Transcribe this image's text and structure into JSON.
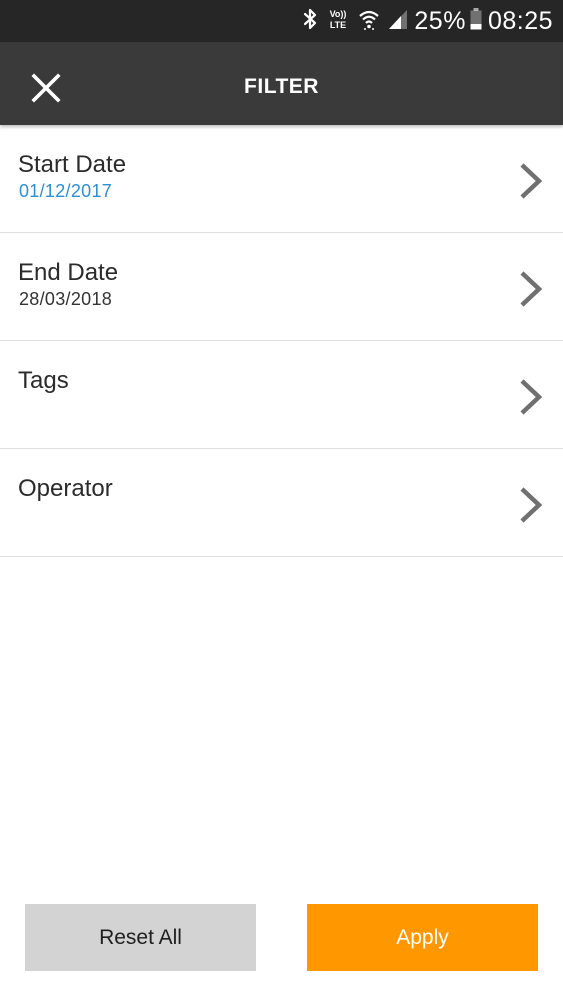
{
  "status_bar": {
    "network_label": "VoLTE",
    "battery": "25%",
    "time": "08:25"
  },
  "app_bar": {
    "title": "FILTER"
  },
  "filters": [
    {
      "label": "Start Date",
      "value": "01/12/2017"
    },
    {
      "label": "End Date",
      "value": "28/03/2018"
    },
    {
      "label": "Tags",
      "value": ""
    },
    {
      "label": "Operator",
      "value": ""
    }
  ],
  "actions": {
    "reset_label": "Reset All",
    "apply_label": "Apply"
  },
  "colors": {
    "status_bar": "#262626",
    "app_bar": "#3a3a3a",
    "accent_value": "#2f8fd0",
    "apply_button": "#ff9800",
    "reset_button": "#d3d3d3"
  },
  "icons": {
    "close": "close-icon",
    "chevron": "chevron-right-icon",
    "bluetooth": "bluetooth-icon",
    "wifi": "wifi-icon",
    "signal": "signal-icon",
    "battery": "battery-icon"
  }
}
